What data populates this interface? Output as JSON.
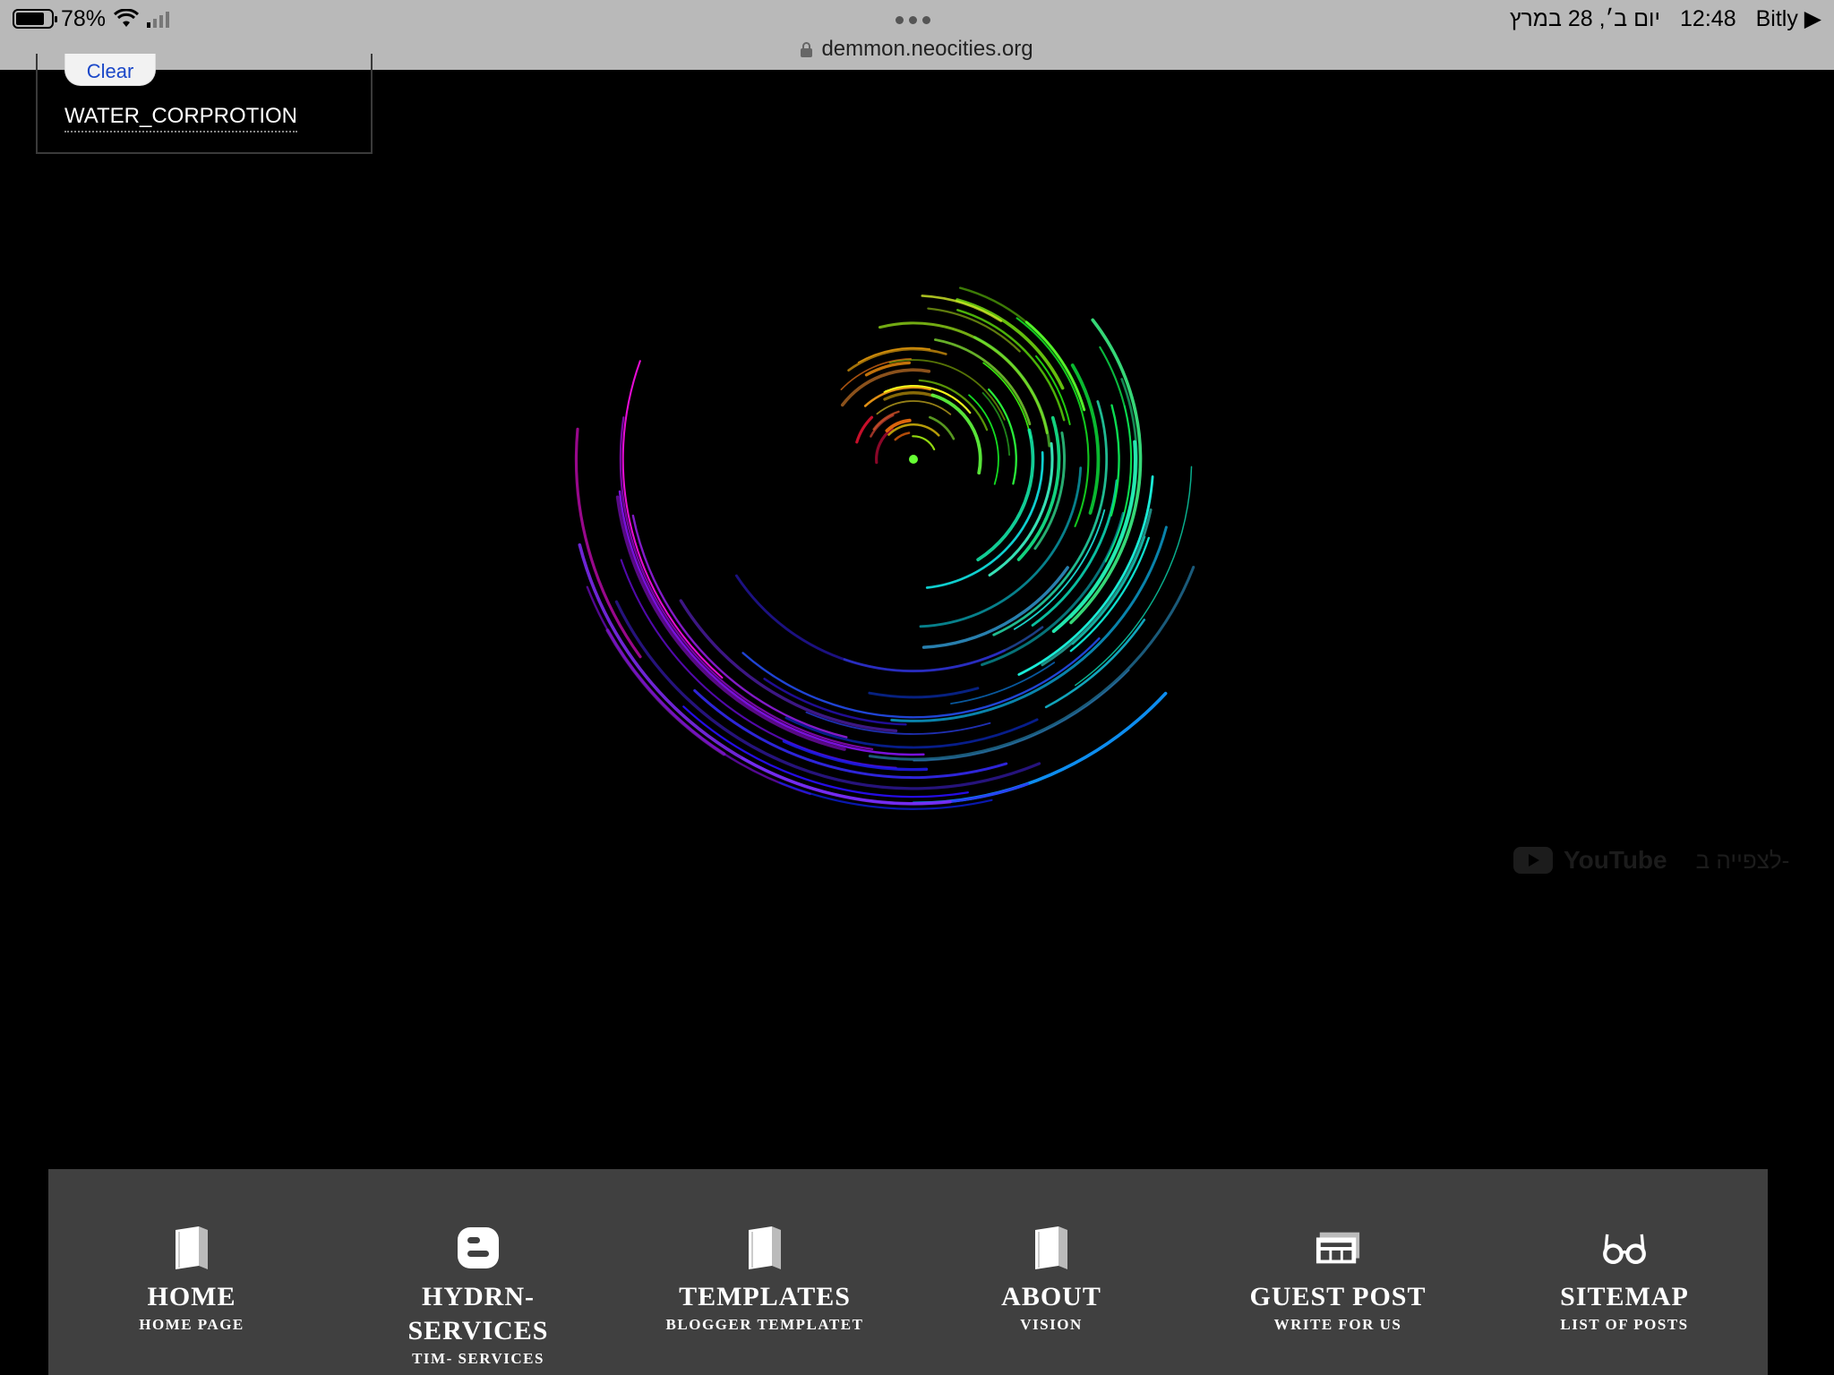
{
  "status_bar": {
    "battery": "78%",
    "battery_level": 0.78,
    "date": "יום ב׳, 28 במרץ",
    "time": "12:48",
    "back_app": "Bitly"
  },
  "browser": {
    "url": "demmon.neocities.org"
  },
  "widget": {
    "clear_label": "Clear",
    "tag_label": "WATER_CORPROTION"
  },
  "video_overlay": {
    "youtube_label": "YouTube",
    "watch_on_hebrew": "לצפייה ב-"
  },
  "nav": {
    "items": [
      {
        "title": "HOME",
        "subtitle": "HOME PAGE",
        "icon": "book-icon"
      },
      {
        "title": "HYDRN- SERVICES",
        "subtitle": "TIM- SERVICES",
        "icon": "blogger-icon"
      },
      {
        "title": "TEMPLATES",
        "subtitle": "BLOGGER TEMPLATET",
        "icon": "book-icon"
      },
      {
        "title": "ABOUT",
        "subtitle": "VISION",
        "icon": "book-icon"
      },
      {
        "title": "GUEST POST",
        "subtitle": "WRITE FOR US",
        "icon": "newspaper-icon"
      },
      {
        "title": "SITEMAP",
        "subtitle": "LIST OF POSTS",
        "icon": "glasses-icon"
      }
    ]
  },
  "colors": {
    "background": "#000000",
    "nav_background": "#404040",
    "topbar": "#b9b9b9",
    "clear_text": "#1a47c8"
  }
}
